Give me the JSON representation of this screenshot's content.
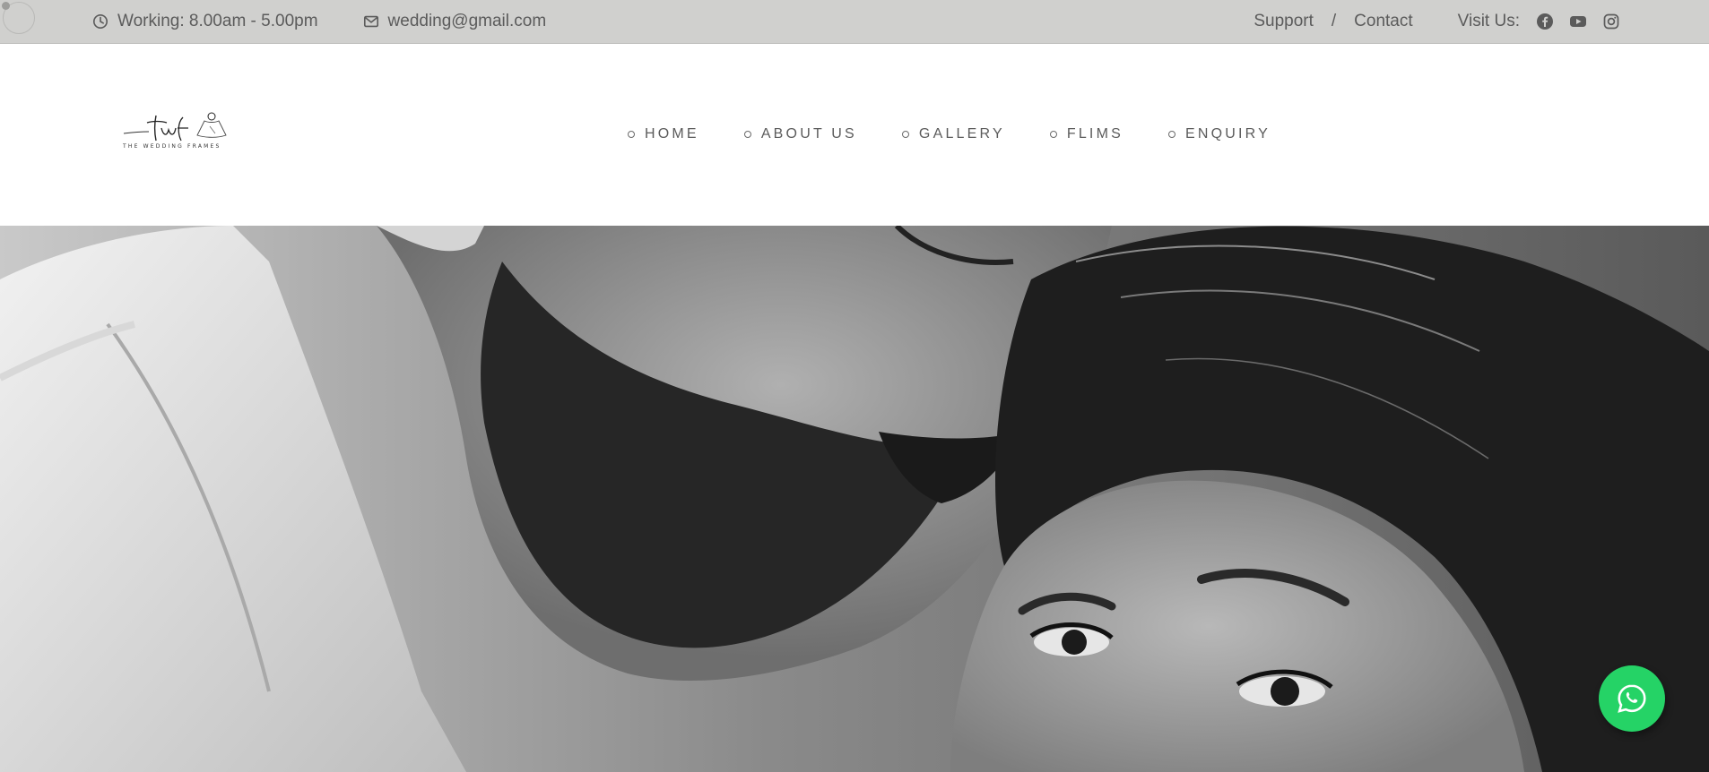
{
  "topbar": {
    "hours": "Working: 8.00am - 5.00pm",
    "email": "wedding@gmail.com",
    "support": "Support",
    "separator": "/",
    "contact": "Contact",
    "visit": "Visit Us:",
    "icons": {
      "hours": "clock-icon",
      "email": "envelope-icon",
      "social": [
        "facebook-icon",
        "youtube-icon",
        "instagram-icon"
      ]
    },
    "bg": "#d0d0ce",
    "text_color": "#5b5b5b"
  },
  "header": {
    "logo": {
      "mark": "Twf",
      "caption": "THE WEDDING FRAMES"
    },
    "nav": [
      {
        "label": "HOME"
      },
      {
        "label": "ABOUT US"
      },
      {
        "label": "GALLERY"
      },
      {
        "label": "FLIMS"
      },
      {
        "label": "ENQUIRY"
      }
    ]
  },
  "hero": {
    "image": "black-and-white couple portrait"
  },
  "whatsapp": {
    "icon": "whatsapp-icon",
    "color": "#25d366"
  }
}
